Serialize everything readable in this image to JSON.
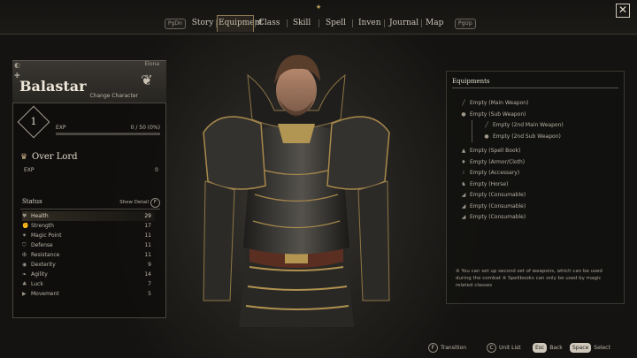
{
  "nav": {
    "left_key": "PgDn",
    "right_key": "PgUp",
    "tabs": [
      "Story",
      "Equipment",
      "Class",
      "Skill",
      "Spell",
      "Inven",
      "Journal",
      "Map"
    ],
    "active_tab": "Equipment"
  },
  "character": {
    "name": "Balastar",
    "companion_label": "Elona",
    "change_label": "Change Character",
    "level": "1",
    "exp_label": "EXP",
    "exp_value": "0 / 50 (0%)",
    "exp_progress": 0,
    "class_name": "Over Lord",
    "class_exp_label": "EXP",
    "class_exp_value": "0"
  },
  "status": {
    "title": "Status",
    "show_detail": "Show Detail",
    "show_detail_key": "F",
    "stats": [
      {
        "label": "Health",
        "value": "29",
        "icon": "heart-icon"
      },
      {
        "label": "Strength",
        "value": "17",
        "icon": "fist-icon"
      },
      {
        "label": "Magic Point",
        "value": "11",
        "icon": "magic-icon"
      },
      {
        "label": "Defense",
        "value": "11",
        "icon": "shield-icon"
      },
      {
        "label": "Resistance",
        "value": "11",
        "icon": "resist-icon"
      },
      {
        "label": "Dexterity",
        "value": "9",
        "icon": "eye-icon"
      },
      {
        "label": "Agility",
        "value": "14",
        "icon": "wing-icon"
      },
      {
        "label": "Luck",
        "value": "7",
        "icon": "clover-icon"
      },
      {
        "label": "Movement",
        "value": "5",
        "icon": "boot-icon"
      }
    ]
  },
  "equipment": {
    "title": "Equipments",
    "slots": [
      {
        "label": "Empty (Main Weapon)",
        "icon": "sword-icon",
        "sub": false
      },
      {
        "label": "Empty (Sub Weapon)",
        "icon": "buckler-icon",
        "sub": false
      },
      {
        "label": "Empty (2nd Main Weapon)",
        "icon": "sword-icon",
        "sub": true
      },
      {
        "label": "Empty (2nd Sub Weapon)",
        "icon": "buckler-icon",
        "sub": true
      },
      {
        "label": "Empty (Spell Book)",
        "icon": "book-icon",
        "sub": false
      },
      {
        "label": "Empty (Armor/Cloth)",
        "icon": "armor-icon",
        "sub": false
      },
      {
        "label": "Empty (Accessary)",
        "icon": "ring-icon",
        "sub": false
      },
      {
        "label": "Empty (Horse)",
        "icon": "horse-icon",
        "sub": false
      },
      {
        "label": "Empty (Consumable)",
        "icon": "potion-icon",
        "sub": false
      },
      {
        "label": "Empty (Consumable)",
        "icon": "potion-icon",
        "sub": false
      },
      {
        "label": "Empty (Consumable)",
        "icon": "potion-icon",
        "sub": false
      }
    ],
    "note": "※ You can set up second set of weapons, which can be used during the combat ※ Spellbooks can only be used by magic related classes"
  },
  "hints": [
    {
      "key": "F",
      "label": "Transition"
    },
    {
      "key": "C",
      "label": "Unit List"
    },
    {
      "key": "Esc",
      "label": "Back"
    },
    {
      "key": "Space",
      "label": "Select"
    }
  ]
}
